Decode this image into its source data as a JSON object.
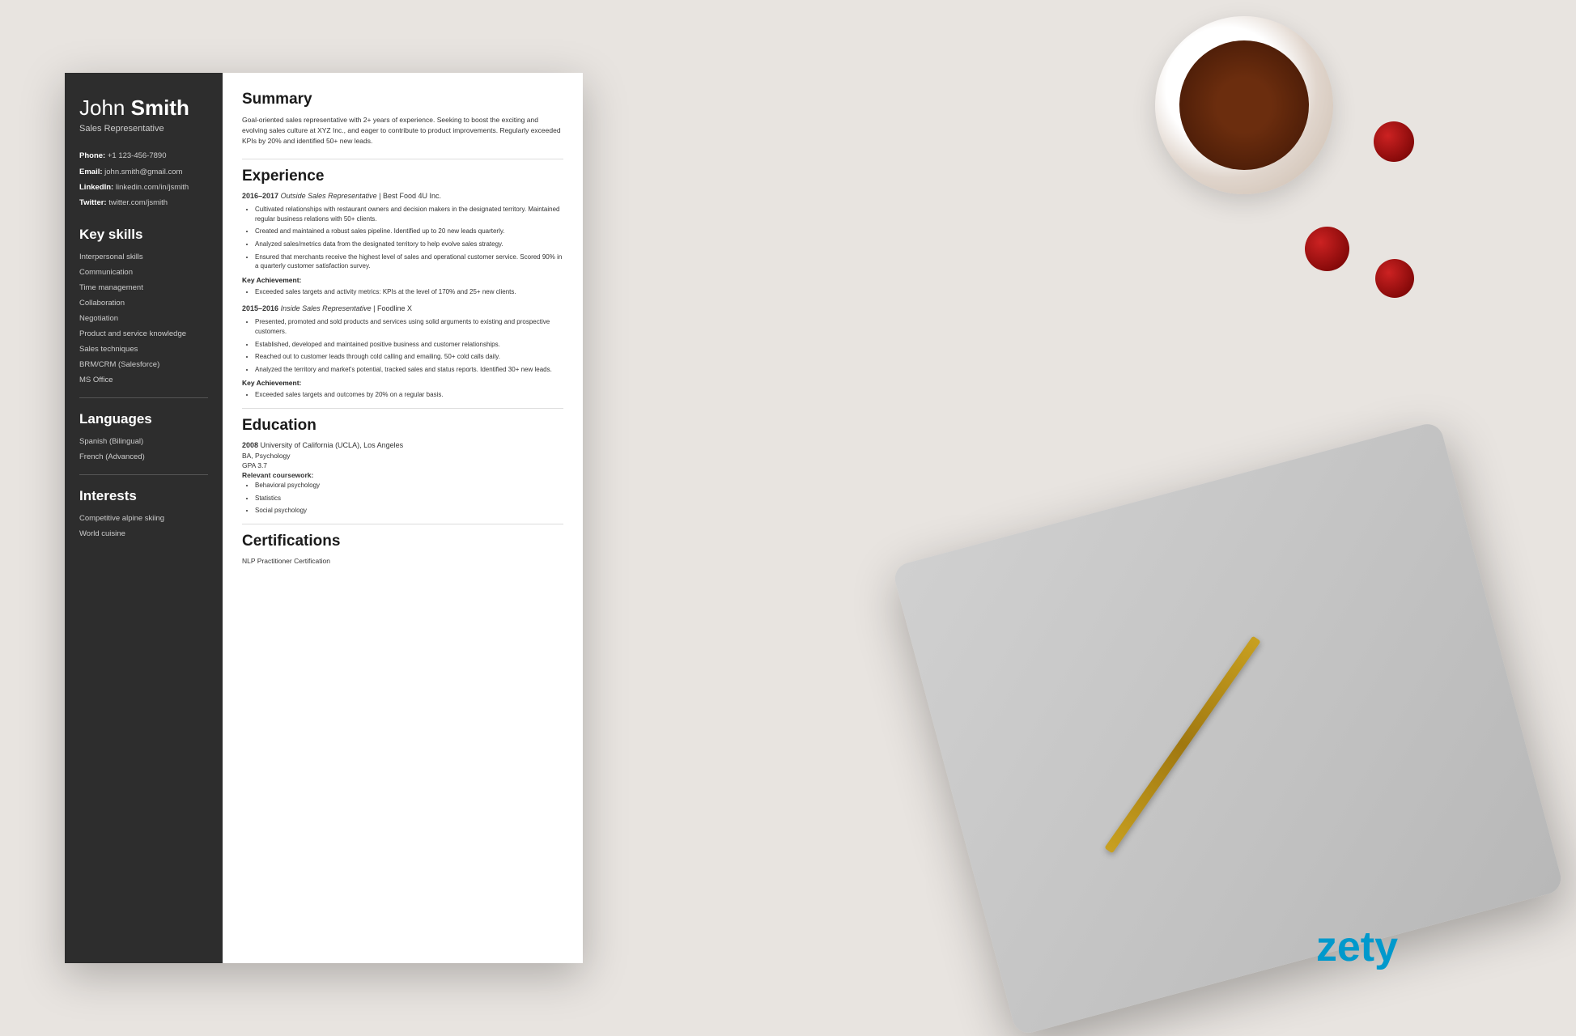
{
  "background": {
    "color": "#d8d8d8"
  },
  "zety": {
    "logo": "zety"
  },
  "resume": {
    "sidebar": {
      "name_first": "John ",
      "name_last": "Smith",
      "title": "Sales Representative",
      "contact": {
        "phone_label": "Phone:",
        "phone": "+1 123-456-7890",
        "email_label": "Email:",
        "email": "john.smith@gmail.com",
        "linkedin_label": "LinkedIn:",
        "linkedin": "linkedin.com/in/jsmith",
        "twitter_label": "Twitter:",
        "twitter": "twitter.com/jsmith"
      },
      "skills_title": "Key skills",
      "skills": [
        "Interpersonal skills",
        "Communication",
        "Time management",
        "Collaboration",
        "Negotiation",
        "Product and service knowledge",
        "Sales techniques",
        "BRM/CRM (Salesforce)",
        "MS Office"
      ],
      "languages_title": "Languages",
      "languages": [
        "Spanish (Bilingual)",
        "French (Advanced)"
      ],
      "interests_title": "Interests",
      "interests": [
        "Competitive alpine skiing",
        "World cuisine"
      ]
    },
    "main": {
      "summary_title": "Summary",
      "summary_text": "Goal-oriented sales representative with 2+ years of experience. Seeking to boost the exciting and evolving sales culture at XYZ Inc., and eager to contribute to product improvements. Regularly exceeded KPIs by 20% and identified 50+ new leads.",
      "experience_title": "Experience",
      "jobs": [
        {
          "years": "2016–2017",
          "role": "Outside Sales Representative",
          "company": "Best Food 4U Inc.",
          "bullets": [
            "Cultivated relationships with restaurant owners and decision makers in the designated territory. Maintained regular business relations with 50+ clients.",
            "Created and maintained a robust sales pipeline. Identified up to 20 new leads quarterly.",
            "Analyzed sales/metrics data from the designated territory to help evolve sales strategy.",
            "Ensured that merchants receive the highest level of sales and operational customer service. Scored 90% in a quarterly customer satisfaction survey."
          ],
          "achievement_label": "Key Achievement:",
          "achievement_bullets": [
            "Exceeded sales targets and activity metrics: KPIs at the level of 170% and 25+ new clients."
          ]
        },
        {
          "years": "2015–2016",
          "role": "Inside Sales Representative",
          "company": "Foodline X",
          "bullets": [
            "Presented, promoted and sold products and services using solid arguments to existing and prospective customers.",
            "Established, developed and maintained positive business and customer relationships.",
            "Reached out to customer leads through cold calling and emailing. 50+ cold calls daily.",
            "Analyzed the territory and market's potential, tracked sales and status reports. Identified 30+ new leads."
          ],
          "achievement_label": "Key Achievement:",
          "achievement_bullets": [
            "Exceeded sales targets and outcomes by 20% on a regular basis."
          ]
        }
      ],
      "education_title": "Education",
      "education": [
        {
          "year": "2008",
          "school": "University of California (UCLA), Los Angeles",
          "degree": "BA, Psychology",
          "gpa": "GPA 3.7",
          "coursework_label": "Relevant coursework:",
          "coursework": [
            "Behavioral psychology",
            "Statistics",
            "Social psychology"
          ]
        }
      ],
      "certifications_title": "Certifications",
      "certifications": [
        "NLP Practitioner Certification"
      ]
    }
  }
}
